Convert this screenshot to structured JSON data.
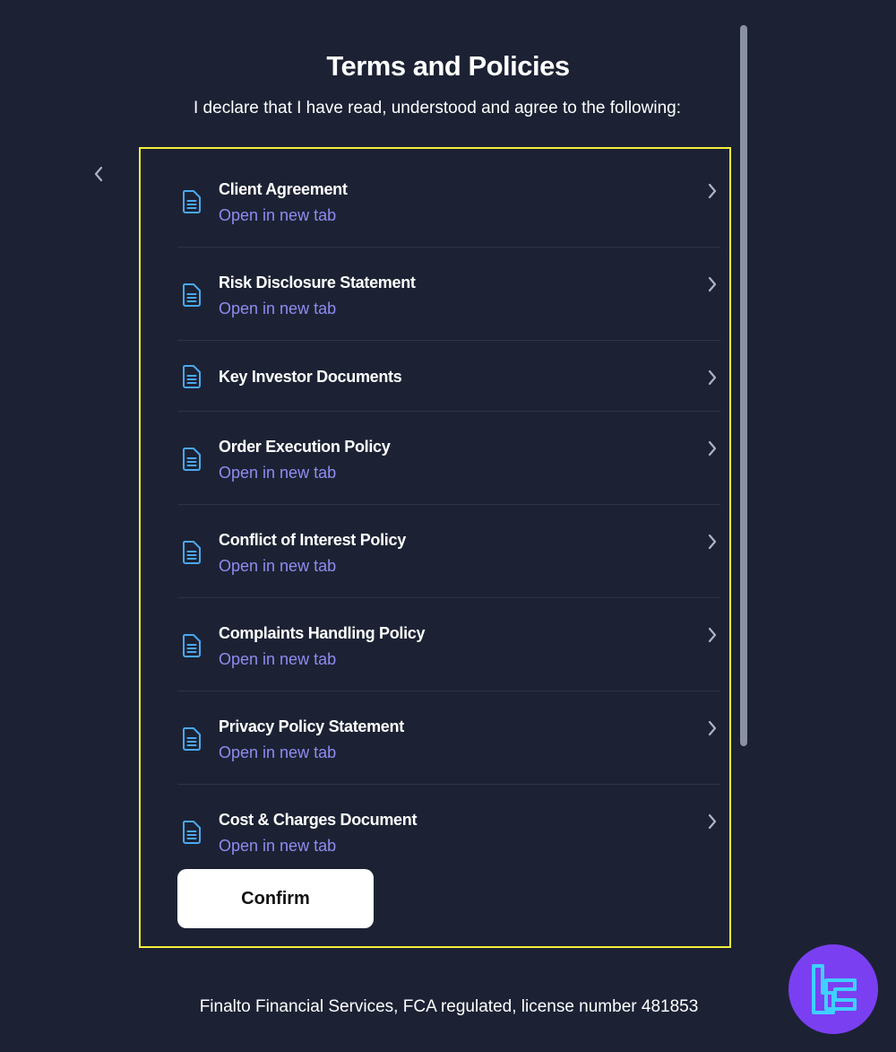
{
  "header": {
    "title": "Terms and Policies",
    "subtitle": "I declare that I have read, understood and agree to the following:"
  },
  "documents": [
    {
      "title": "Client Agreement",
      "link": "Open in new tab"
    },
    {
      "title": "Risk Disclosure Statement",
      "link": "Open in new tab"
    },
    {
      "title": "Key Investor Documents",
      "link": ""
    },
    {
      "title": "Order Execution Policy",
      "link": "Open in new tab"
    },
    {
      "title": "Conflict of Interest Policy",
      "link": "Open in new tab"
    },
    {
      "title": "Complaints Handling Policy",
      "link": "Open in new tab"
    },
    {
      "title": "Privacy Policy Statement",
      "link": "Open in new tab"
    },
    {
      "title": "Cost & Charges Document",
      "link": "Open in new tab"
    }
  ],
  "confirm_label": "Confirm",
  "footer_text": "Finalto Financial Services, FCA regulated, license number 481853",
  "icons": {
    "back": "chevron-left-icon",
    "document": "document-icon",
    "item_arrow": "chevron-right-icon",
    "brand": "brand-logo"
  },
  "colors": {
    "background": "#1c2234",
    "link": "#8f8cf0",
    "document_icon": "#4aa8f0",
    "highlight_border": "#f5f03a",
    "brand_badge": "#7b3ff2",
    "brand_logo": "#3fd0ff"
  }
}
